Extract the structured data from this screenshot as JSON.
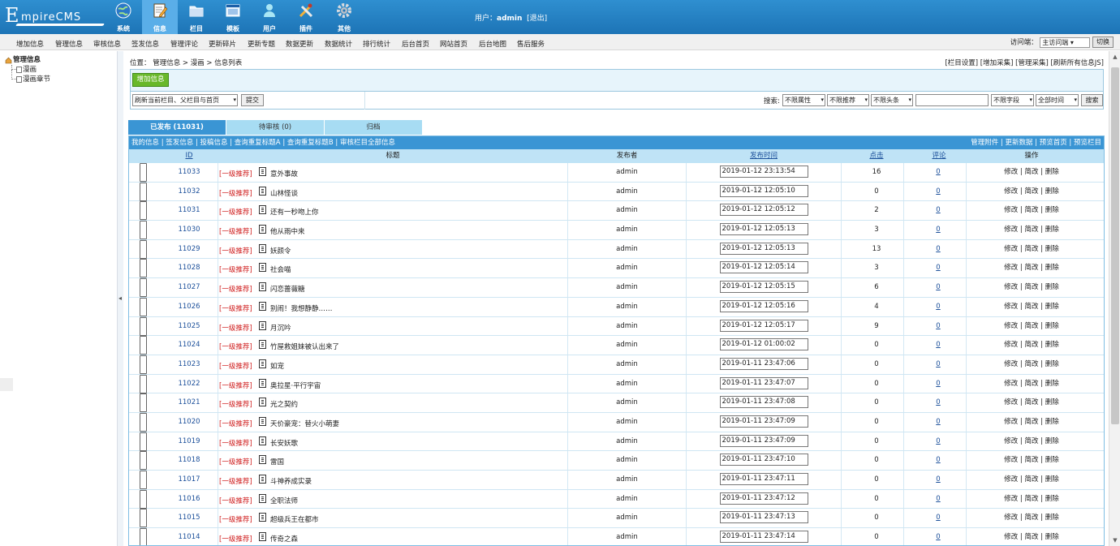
{
  "header": {
    "logo_initial": "E",
    "logo_rest": "mpireCMS",
    "nav": [
      {
        "label": "系统",
        "icon": "globe-icon"
      },
      {
        "label": "信息",
        "icon": "edit-document-icon"
      },
      {
        "label": "栏目",
        "icon": "folder-icon"
      },
      {
        "label": "模板",
        "icon": "template-window-icon"
      },
      {
        "label": "用户",
        "icon": "user-icon"
      },
      {
        "label": "插件",
        "icon": "tools-icon"
      },
      {
        "label": "其他",
        "icon": "gear-icon"
      }
    ],
    "user_label": "用户：",
    "user_name": "admin",
    "logout_label": "[退出]"
  },
  "menubar": {
    "items": [
      "增加信息",
      "管理信息",
      "审核信息",
      "签发信息",
      "管理评论",
      "更新碎片",
      "更新专题",
      "数据更新",
      "数据统计",
      "排行统计",
      "后台首页",
      "网站首页",
      "后台地图",
      "售后服务"
    ],
    "visitor_label": "访问端：",
    "visitor_value": "主访问端",
    "switch_label": "切换"
  },
  "sidebar": {
    "root": "管理信息",
    "children": [
      "漫画",
      "漫画章节"
    ]
  },
  "breadcrumb": {
    "text": "位置： 管理信息 > 漫画 > 信息列表",
    "right": "[栏目设置] [增加采集] [管理采集] [刷新所有信息JS]"
  },
  "toolbar": {
    "add_label": "增加信息",
    "refresh_select": "刷新当前栏目、父栏目与首页",
    "submit_label": "提交",
    "search_label": "搜索:",
    "filter_attr": "不限属性",
    "filter_recommend": "不限推荐",
    "filter_headline": "不限头条",
    "search_value": "",
    "filter_field": "不限字段",
    "filter_time": "全部时间",
    "search_button": "搜索"
  },
  "tabs": [
    "已发布 (11031)",
    "待审核 (0)",
    "归档"
  ],
  "linkbar": {
    "left": "我的信息 | 签发信息 | 投稿信息 | 查询重复标题A | 查询重复标题B | 审核栏目全部信息",
    "right": "管理附件 | 更新数据 | 预览首页 | 预览栏目"
  },
  "table": {
    "headers": {
      "id": "ID",
      "title": "标题",
      "publisher": "发布者",
      "date": "发布时间",
      "clicks": "点击",
      "comments": "评论",
      "ops": "操作"
    },
    "tag": "[一级推荐]",
    "ops": "修改 | 简改 | 删除",
    "rows": [
      {
        "id": "11033",
        "title": "意外事故",
        "publisher": "admin",
        "date": "2019-01-12 23:13:54",
        "clicks": "16",
        "comments": "0"
      },
      {
        "id": "11032",
        "title": "山林怪谈",
        "publisher": "admin",
        "date": "2019-01-12 12:05:10",
        "clicks": "0",
        "comments": "0"
      },
      {
        "id": "11031",
        "title": "还有一秒吻上你",
        "publisher": "admin",
        "date": "2019-01-12 12:05:12",
        "clicks": "2",
        "comments": "0"
      },
      {
        "id": "11030",
        "title": "他从雨中来",
        "publisher": "admin",
        "date": "2019-01-12 12:05:13",
        "clicks": "3",
        "comments": "0"
      },
      {
        "id": "11029",
        "title": "妖颜令",
        "publisher": "admin",
        "date": "2019-01-12 12:05:13",
        "clicks": "13",
        "comments": "0"
      },
      {
        "id": "11028",
        "title": "社会喵",
        "publisher": "admin",
        "date": "2019-01-12 12:05:14",
        "clicks": "3",
        "comments": "0"
      },
      {
        "id": "11027",
        "title": "闪恋蔷薇糖",
        "publisher": "admin",
        "date": "2019-01-12 12:05:15",
        "clicks": "6",
        "comments": "0"
      },
      {
        "id": "11026",
        "title": "别闹！我想静静……",
        "publisher": "admin",
        "date": "2019-01-12 12:05:16",
        "clicks": "4",
        "comments": "0"
      },
      {
        "id": "11025",
        "title": "月沉吟",
        "publisher": "admin",
        "date": "2019-01-12 12:05:17",
        "clicks": "9",
        "comments": "0"
      },
      {
        "id": "11024",
        "title": "竹屋救姐妹被认出来了",
        "publisher": "admin",
        "date": "2019-01-12 01:00:02",
        "clicks": "0",
        "comments": "0"
      },
      {
        "id": "11023",
        "title": "如宠",
        "publisher": "admin",
        "date": "2019-01-11 23:47:06",
        "clicks": "0",
        "comments": "0"
      },
      {
        "id": "11022",
        "title": "奥拉星·平行宇宙",
        "publisher": "admin",
        "date": "2019-01-11 23:47:07",
        "clicks": "0",
        "comments": "0"
      },
      {
        "id": "11021",
        "title": "光之契约",
        "publisher": "admin",
        "date": "2019-01-11 23:47:08",
        "clicks": "0",
        "comments": "0"
      },
      {
        "id": "11020",
        "title": "天价豪宠：替火小萌妻",
        "publisher": "admin",
        "date": "2019-01-11 23:47:09",
        "clicks": "0",
        "comments": "0"
      },
      {
        "id": "11019",
        "title": "长安妖歌",
        "publisher": "admin",
        "date": "2019-01-11 23:47:09",
        "clicks": "0",
        "comments": "0"
      },
      {
        "id": "11018",
        "title": "雷国",
        "publisher": "admin",
        "date": "2019-01-11 23:47:10",
        "clicks": "0",
        "comments": "0"
      },
      {
        "id": "11017",
        "title": "斗神养成实录",
        "publisher": "admin",
        "date": "2019-01-11 23:47:11",
        "clicks": "0",
        "comments": "0"
      },
      {
        "id": "11016",
        "title": "全职法师",
        "publisher": "admin",
        "date": "2019-01-11 23:47:12",
        "clicks": "0",
        "comments": "0"
      },
      {
        "id": "11015",
        "title": "超级兵王在都市",
        "publisher": "admin",
        "date": "2019-01-11 23:47:13",
        "clicks": "0",
        "comments": "0"
      },
      {
        "id": "11014",
        "title": "传奇之森",
        "publisher": "admin",
        "date": "2019-01-11 23:47:14",
        "clicks": "0",
        "comments": "0"
      }
    ]
  }
}
